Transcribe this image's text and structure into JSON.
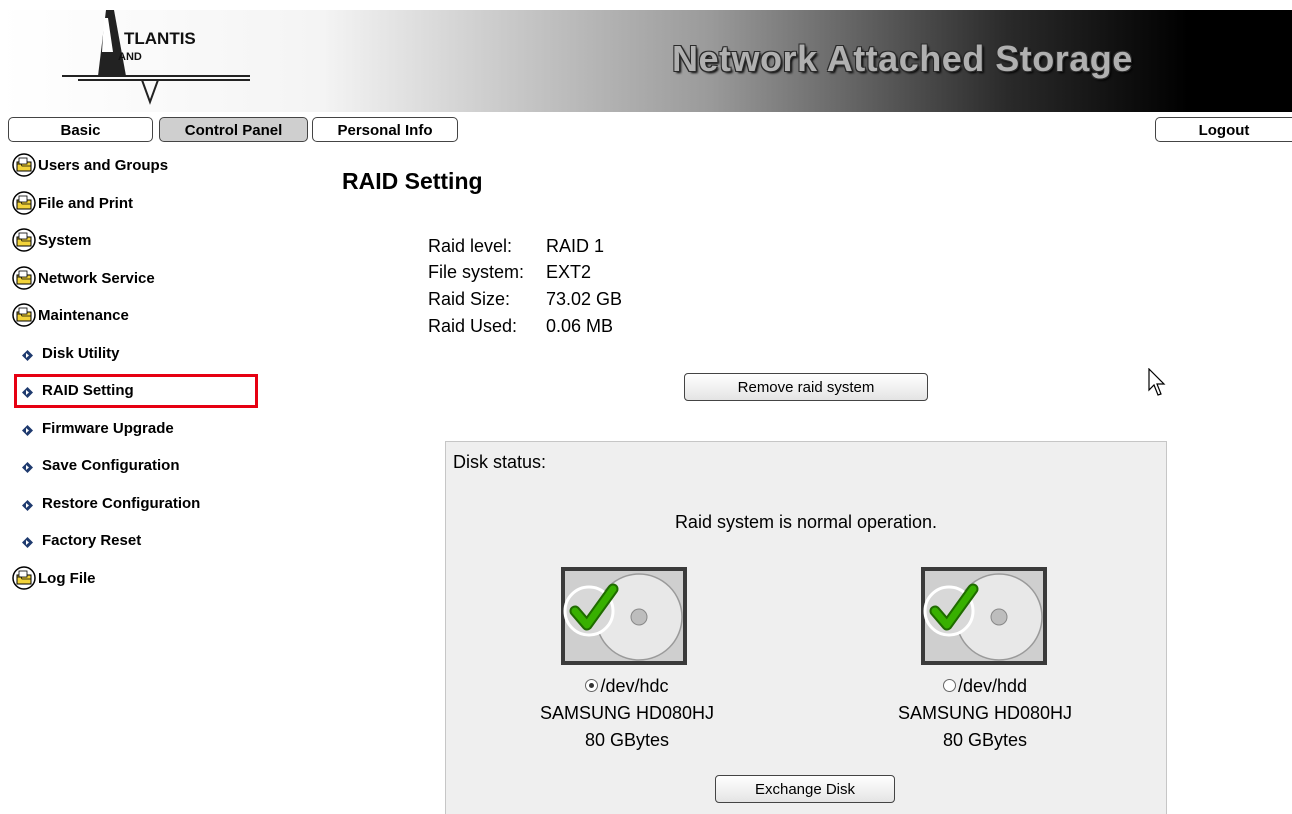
{
  "header": {
    "logo_text": "ATLANTIS AND",
    "banner_title": "Network Attached Storage"
  },
  "tabs": {
    "basic": "Basic",
    "control_panel": "Control Panel",
    "personal_info": "Personal Info",
    "logout": "Logout",
    "active": "Control Panel"
  },
  "sidebar": {
    "items": [
      {
        "label": "Users and Groups",
        "icon": "folder-icon"
      },
      {
        "label": "File and Print",
        "icon": "folder-icon"
      },
      {
        "label": "System",
        "icon": "folder-icon"
      },
      {
        "label": "Network Service",
        "icon": "folder-icon"
      },
      {
        "label": "Maintenance",
        "icon": "folder-icon"
      },
      {
        "label": "Disk Utility",
        "icon": "bullet-icon"
      },
      {
        "label": "RAID Setting",
        "icon": "bullet-icon",
        "selected": true
      },
      {
        "label": "Firmware Upgrade",
        "icon": "bullet-icon"
      },
      {
        "label": "Save Configuration",
        "icon": "bullet-icon"
      },
      {
        "label": "Restore Configuration",
        "icon": "bullet-icon"
      },
      {
        "label": "Factory Reset",
        "icon": "bullet-icon"
      },
      {
        "label": "Log File",
        "icon": "folder-icon"
      }
    ]
  },
  "main": {
    "title": "RAID Setting",
    "info": [
      {
        "label": "Raid level:",
        "value": "RAID 1"
      },
      {
        "label": "File system:",
        "value": "EXT2"
      },
      {
        "label": "Raid Size:",
        "value": "73.02 GB"
      },
      {
        "label": "Raid Used:",
        "value": "0.06 MB"
      }
    ],
    "remove_button": "Remove raid system",
    "disk_status_label": "Disk status:",
    "disk_status_message": "Raid system is normal operation.",
    "disks": [
      {
        "device": "/dev/hdc",
        "model": "SAMSUNG HD080HJ",
        "size": "80 GBytes",
        "selected": true
      },
      {
        "device": "/dev/hdd",
        "model": "SAMSUNG HD080HJ",
        "size": "80 GBytes",
        "selected": false
      }
    ],
    "exchange_button": "Exchange Disk"
  },
  "colors": {
    "selection_outline": "#e60012",
    "bullet": "#1e3a6e",
    "panel_background": "#efefef",
    "check_green": "#38b000"
  }
}
